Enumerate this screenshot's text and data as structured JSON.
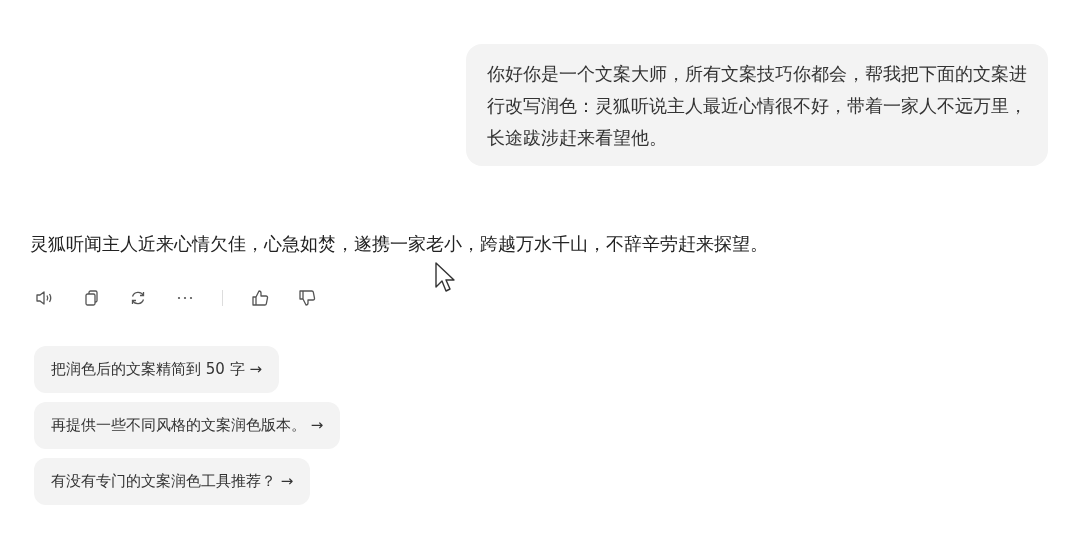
{
  "user_message": "你好你是一个文案大师，所有文案技巧你都会，帮我把下面的文案进行改写润色：灵狐听说主人最近心情很不好，带着一家人不远万里，长途跋涉赶来看望他。",
  "reply": "灵狐听闻主人近来心情欠佳，心急如焚，遂携一家老小，跨越万水千山，不辞辛劳赶来探望。",
  "actions": [
    {
      "kind": "speaker"
    },
    {
      "kind": "copy"
    },
    {
      "kind": "regenerate"
    },
    {
      "kind": "more"
    },
    {
      "kind": "divider"
    },
    {
      "kind": "like"
    },
    {
      "kind": "dislike"
    }
  ],
  "suggestions": [
    "把润色后的文案精简到 50 字 →",
    "再提供一些不同风格的文案润色版本。 →",
    "有没有专门的文案润色工具推荐？ →"
  ]
}
